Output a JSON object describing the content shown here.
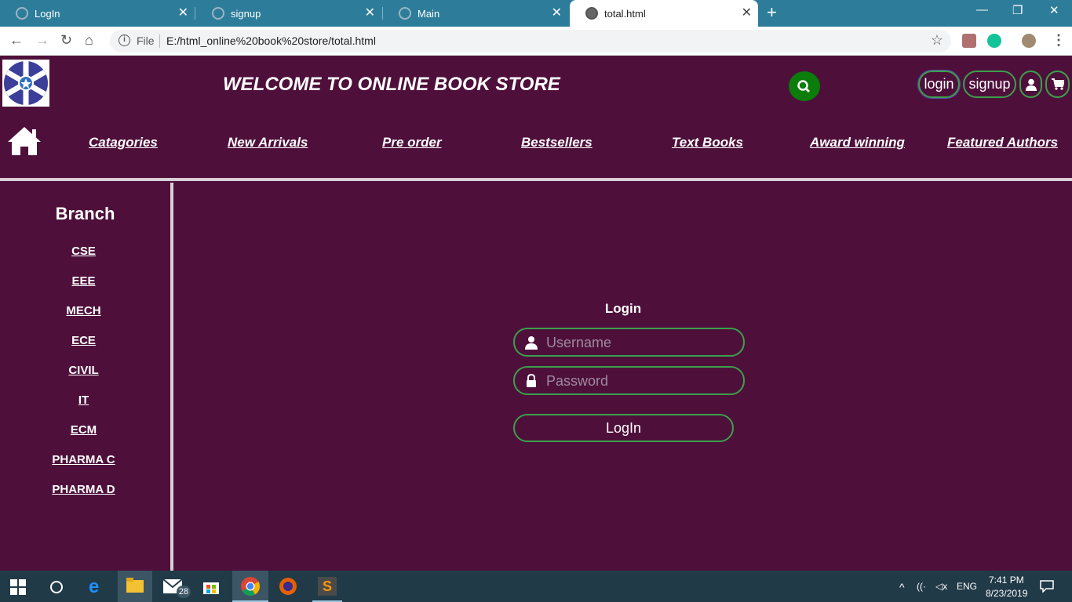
{
  "browser": {
    "tabs": [
      {
        "title": "LogIn"
      },
      {
        "title": "signup"
      },
      {
        "title": "Main"
      },
      {
        "title": "total.html"
      }
    ],
    "address_bar": {
      "scheme_label": "File",
      "url": "E:/html_online%20book%20store/total.html"
    }
  },
  "header": {
    "title": "WELCOME TO ONLINE BOOK STORE",
    "login_label": "login",
    "signup_label": "signup"
  },
  "nav": {
    "items": [
      "Catagories",
      "New Arrivals",
      "Pre order",
      "Bestsellers",
      "Text Books",
      "Award winning",
      "Featured Authors"
    ]
  },
  "sidebar": {
    "title": "Branch",
    "items": [
      "CSE",
      "EEE",
      "MECH",
      "ECE",
      "CIVIL",
      "IT",
      "ECM",
      "PHARMA C",
      "PHARMA D"
    ]
  },
  "login_form": {
    "title": "Login",
    "username_placeholder": "Username",
    "password_placeholder": "Password",
    "submit_label": "LogIn"
  },
  "taskbar": {
    "mail_badge": "28",
    "language": "ENG",
    "time": "7:41 PM",
    "date": "8/23/2019"
  },
  "colors": {
    "page_background": "#4e103b",
    "accent_border": "#3aa04a",
    "search_button": "#0a7d0a",
    "tab_strip": "#2d7d9a"
  }
}
